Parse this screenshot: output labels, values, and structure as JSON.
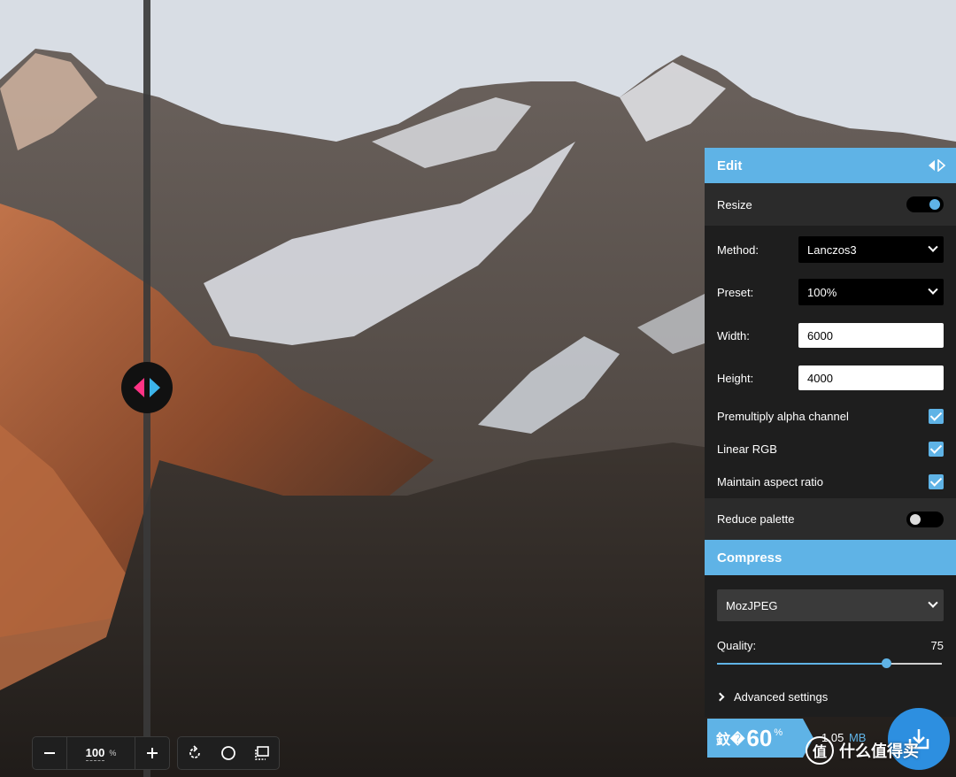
{
  "viewer": {
    "zoom_value": "100",
    "zoom_unit": "%",
    "zoom_out_label": "−",
    "zoom_in_label": "+",
    "icons": [
      "minus-icon",
      "plus-icon",
      "rotate-icon",
      "circle-icon",
      "crop-frame-icon"
    ]
  },
  "edit": {
    "title": "Edit",
    "resize_label": "Resize",
    "resize_enabled": true,
    "method_label": "Method:",
    "method_value": "Lanczos3",
    "preset_label": "Preset:",
    "preset_value": "100%",
    "width_label": "Width:",
    "width_value": "6000",
    "height_label": "Height:",
    "height_value": "4000",
    "premultiply_label": "Premultiply alpha channel",
    "premultiply_checked": true,
    "linear_rgb_label": "Linear RGB",
    "linear_rgb_checked": true,
    "aspect_label": "Maintain aspect ratio",
    "aspect_checked": true,
    "reduce_palette_label": "Reduce palette",
    "reduce_palette_enabled": false
  },
  "compress": {
    "title": "Compress",
    "codec_value": "MozJPEG",
    "quality_label": "Quality:",
    "quality_value": "75",
    "quality_fraction": 0.75,
    "advanced_label": "Advanced settings"
  },
  "results": {
    "saving_glyph": "鈫�",
    "saving_percent": "60",
    "saving_sign": "%",
    "size_value": "1.05",
    "size_unit": "MB"
  },
  "watermark": {
    "logo_text": "值",
    "text": "什么值得买"
  },
  "colors": {
    "accent": "#5fb3e6",
    "panel_bg": "#2b2b2b",
    "panel_dark": "#1e1e1e",
    "handle_left": "#ff3385",
    "handle_right": "#3cb4ea",
    "download": "#2d8fe0"
  }
}
